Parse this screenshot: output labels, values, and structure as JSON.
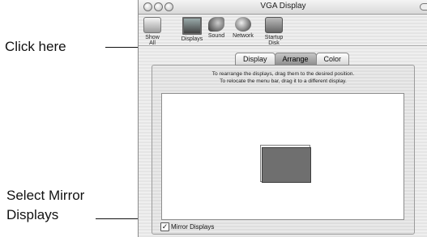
{
  "callouts": {
    "click_here": "Click here",
    "select_mirror_line1": "Select Mirror",
    "select_mirror_line2": "Displays"
  },
  "window": {
    "title": "VGA Display"
  },
  "toolbar": {
    "items": [
      {
        "label": "Show All",
        "icon": "show-all-icon"
      },
      {
        "label": "Displays",
        "icon": "displays-icon"
      },
      {
        "label": "Sound",
        "icon": "sound-icon"
      },
      {
        "label": "Network",
        "icon": "network-icon"
      },
      {
        "label": "Startup Disk",
        "icon": "startup-disk-icon"
      }
    ]
  },
  "tabs": [
    {
      "label": "Display",
      "selected": false
    },
    {
      "label": "Arrange",
      "selected": true
    },
    {
      "label": "Color",
      "selected": false
    }
  ],
  "instructions": {
    "line1": "To rearrange the displays, drag them to the desired position.",
    "line2": "To relocate the menu bar, drag it to a different display."
  },
  "mirror": {
    "label": "Mirror Displays",
    "checked": true,
    "check_glyph": "✓"
  },
  "colors": {
    "display_fill": "#6f6f6f",
    "selected_tab": "#9a9a9a"
  }
}
